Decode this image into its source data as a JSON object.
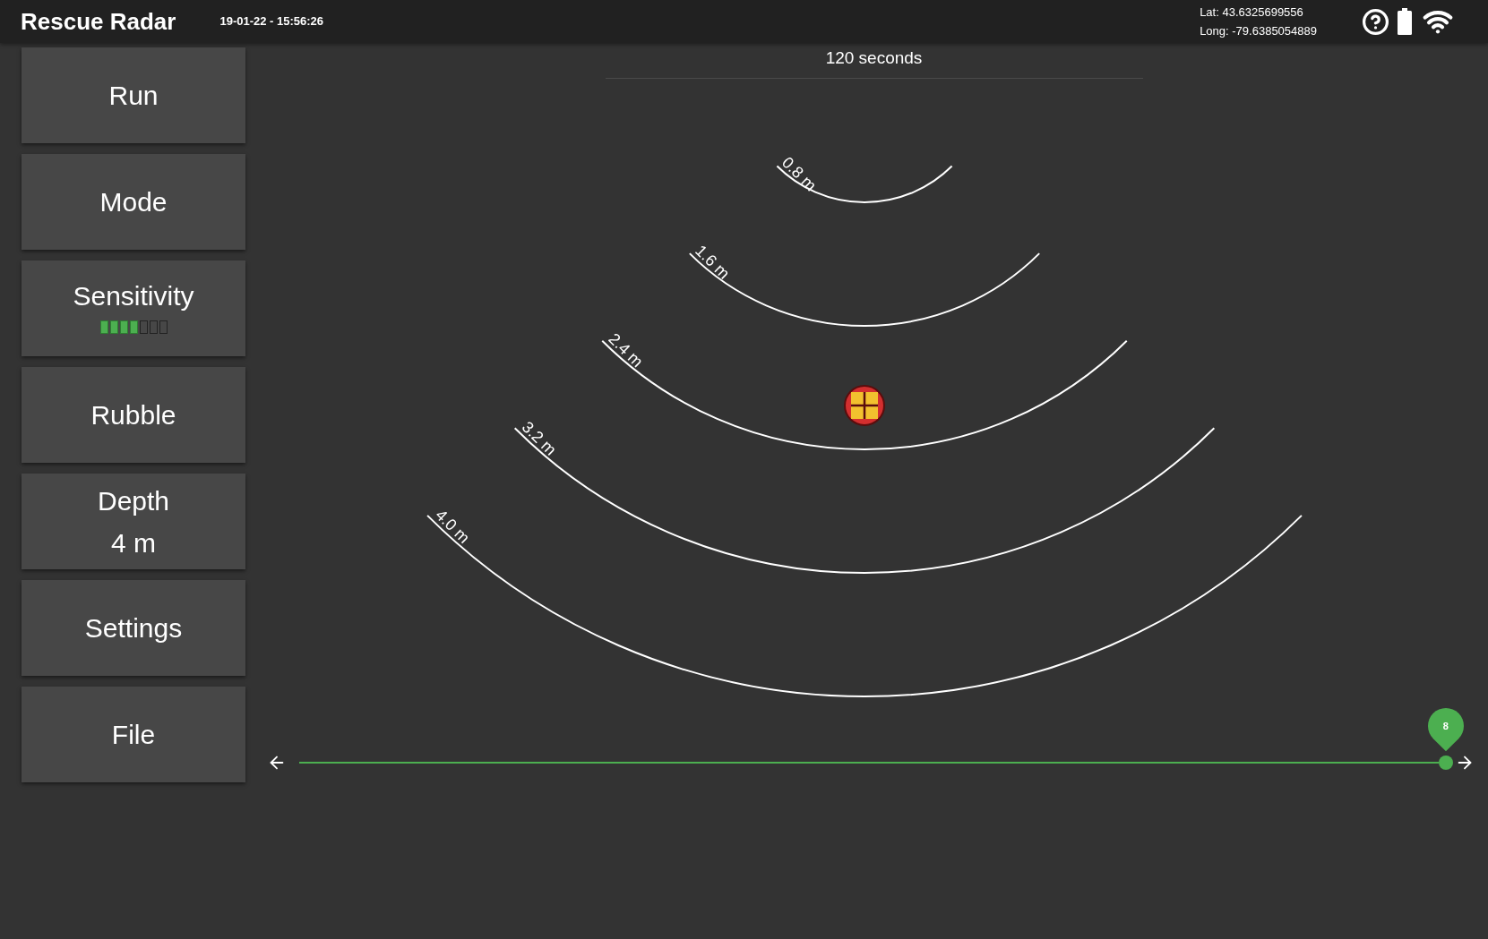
{
  "header": {
    "title": "Rescue Radar",
    "datetime": "19-01-22 - 15:56:26",
    "latitude": "Lat: 43.6325699556",
    "longitude": "Long: -79.6385054889"
  },
  "menu": [
    {
      "kind": "button",
      "label": "Run"
    },
    {
      "kind": "button",
      "label": "Mode"
    },
    {
      "kind": "meter",
      "label": "Sensitivity",
      "level": 0.571
    },
    {
      "kind": "button",
      "label": "Rubble"
    },
    {
      "kind": "value",
      "label": "Depth",
      "value": "4 m"
    },
    {
      "kind": "button",
      "label": "Settings"
    },
    {
      "kind": "button",
      "label": "File"
    }
  ],
  "radar": {
    "duration": "120 seconds",
    "rings": [
      {
        "label": "0.8 m"
      },
      {
        "label": "1.6 m"
      },
      {
        "label": "2.4 m"
      },
      {
        "label": "3.2 m"
      },
      {
        "label": "4.0 m"
      }
    ]
  },
  "timeline": {
    "level": 1,
    "marker": "8"
  }
}
